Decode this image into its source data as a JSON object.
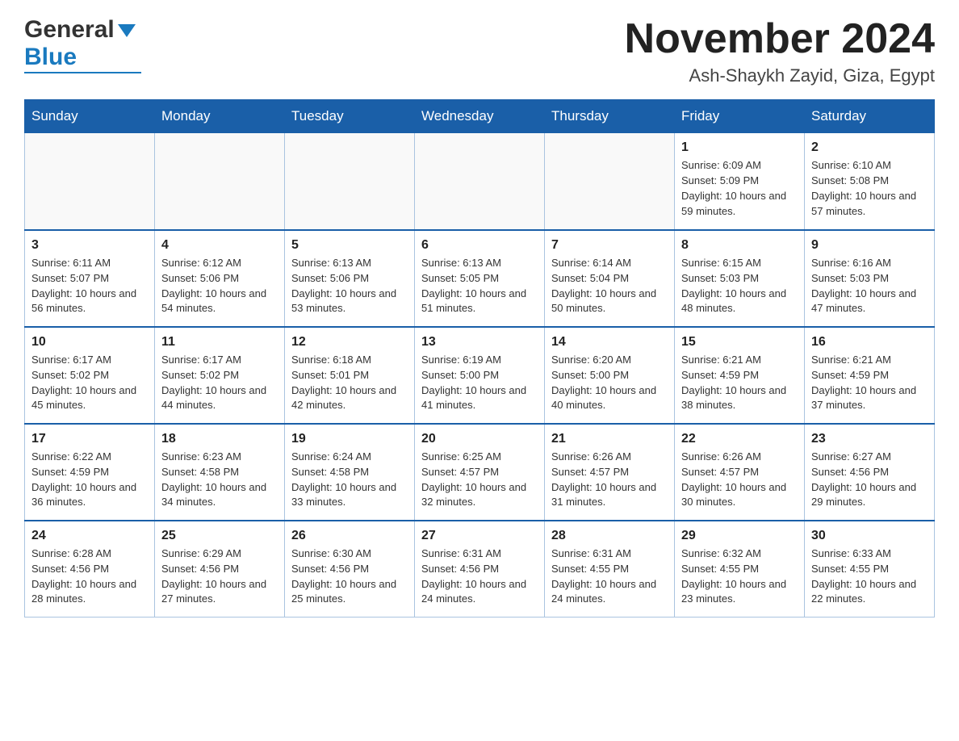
{
  "header": {
    "logo_general": "General",
    "logo_blue": "Blue",
    "month_title": "November 2024",
    "location": "Ash-Shaykh Zayid, Giza, Egypt"
  },
  "weekdays": [
    "Sunday",
    "Monday",
    "Tuesday",
    "Wednesday",
    "Thursday",
    "Friday",
    "Saturday"
  ],
  "weeks": [
    [
      {
        "day": "",
        "info": ""
      },
      {
        "day": "",
        "info": ""
      },
      {
        "day": "",
        "info": ""
      },
      {
        "day": "",
        "info": ""
      },
      {
        "day": "",
        "info": ""
      },
      {
        "day": "1",
        "info": "Sunrise: 6:09 AM\nSunset: 5:09 PM\nDaylight: 10 hours and 59 minutes."
      },
      {
        "day": "2",
        "info": "Sunrise: 6:10 AM\nSunset: 5:08 PM\nDaylight: 10 hours and 57 minutes."
      }
    ],
    [
      {
        "day": "3",
        "info": "Sunrise: 6:11 AM\nSunset: 5:07 PM\nDaylight: 10 hours and 56 minutes."
      },
      {
        "day": "4",
        "info": "Sunrise: 6:12 AM\nSunset: 5:06 PM\nDaylight: 10 hours and 54 minutes."
      },
      {
        "day": "5",
        "info": "Sunrise: 6:13 AM\nSunset: 5:06 PM\nDaylight: 10 hours and 53 minutes."
      },
      {
        "day": "6",
        "info": "Sunrise: 6:13 AM\nSunset: 5:05 PM\nDaylight: 10 hours and 51 minutes."
      },
      {
        "day": "7",
        "info": "Sunrise: 6:14 AM\nSunset: 5:04 PM\nDaylight: 10 hours and 50 minutes."
      },
      {
        "day": "8",
        "info": "Sunrise: 6:15 AM\nSunset: 5:03 PM\nDaylight: 10 hours and 48 minutes."
      },
      {
        "day": "9",
        "info": "Sunrise: 6:16 AM\nSunset: 5:03 PM\nDaylight: 10 hours and 47 minutes."
      }
    ],
    [
      {
        "day": "10",
        "info": "Sunrise: 6:17 AM\nSunset: 5:02 PM\nDaylight: 10 hours and 45 minutes."
      },
      {
        "day": "11",
        "info": "Sunrise: 6:17 AM\nSunset: 5:02 PM\nDaylight: 10 hours and 44 minutes."
      },
      {
        "day": "12",
        "info": "Sunrise: 6:18 AM\nSunset: 5:01 PM\nDaylight: 10 hours and 42 minutes."
      },
      {
        "day": "13",
        "info": "Sunrise: 6:19 AM\nSunset: 5:00 PM\nDaylight: 10 hours and 41 minutes."
      },
      {
        "day": "14",
        "info": "Sunrise: 6:20 AM\nSunset: 5:00 PM\nDaylight: 10 hours and 40 minutes."
      },
      {
        "day": "15",
        "info": "Sunrise: 6:21 AM\nSunset: 4:59 PM\nDaylight: 10 hours and 38 minutes."
      },
      {
        "day": "16",
        "info": "Sunrise: 6:21 AM\nSunset: 4:59 PM\nDaylight: 10 hours and 37 minutes."
      }
    ],
    [
      {
        "day": "17",
        "info": "Sunrise: 6:22 AM\nSunset: 4:59 PM\nDaylight: 10 hours and 36 minutes."
      },
      {
        "day": "18",
        "info": "Sunrise: 6:23 AM\nSunset: 4:58 PM\nDaylight: 10 hours and 34 minutes."
      },
      {
        "day": "19",
        "info": "Sunrise: 6:24 AM\nSunset: 4:58 PM\nDaylight: 10 hours and 33 minutes."
      },
      {
        "day": "20",
        "info": "Sunrise: 6:25 AM\nSunset: 4:57 PM\nDaylight: 10 hours and 32 minutes."
      },
      {
        "day": "21",
        "info": "Sunrise: 6:26 AM\nSunset: 4:57 PM\nDaylight: 10 hours and 31 minutes."
      },
      {
        "day": "22",
        "info": "Sunrise: 6:26 AM\nSunset: 4:57 PM\nDaylight: 10 hours and 30 minutes."
      },
      {
        "day": "23",
        "info": "Sunrise: 6:27 AM\nSunset: 4:56 PM\nDaylight: 10 hours and 29 minutes."
      }
    ],
    [
      {
        "day": "24",
        "info": "Sunrise: 6:28 AM\nSunset: 4:56 PM\nDaylight: 10 hours and 28 minutes."
      },
      {
        "day": "25",
        "info": "Sunrise: 6:29 AM\nSunset: 4:56 PM\nDaylight: 10 hours and 27 minutes."
      },
      {
        "day": "26",
        "info": "Sunrise: 6:30 AM\nSunset: 4:56 PM\nDaylight: 10 hours and 25 minutes."
      },
      {
        "day": "27",
        "info": "Sunrise: 6:31 AM\nSunset: 4:56 PM\nDaylight: 10 hours and 24 minutes."
      },
      {
        "day": "28",
        "info": "Sunrise: 6:31 AM\nSunset: 4:55 PM\nDaylight: 10 hours and 24 minutes."
      },
      {
        "day": "29",
        "info": "Sunrise: 6:32 AM\nSunset: 4:55 PM\nDaylight: 10 hours and 23 minutes."
      },
      {
        "day": "30",
        "info": "Sunrise: 6:33 AM\nSunset: 4:55 PM\nDaylight: 10 hours and 22 minutes."
      }
    ]
  ]
}
